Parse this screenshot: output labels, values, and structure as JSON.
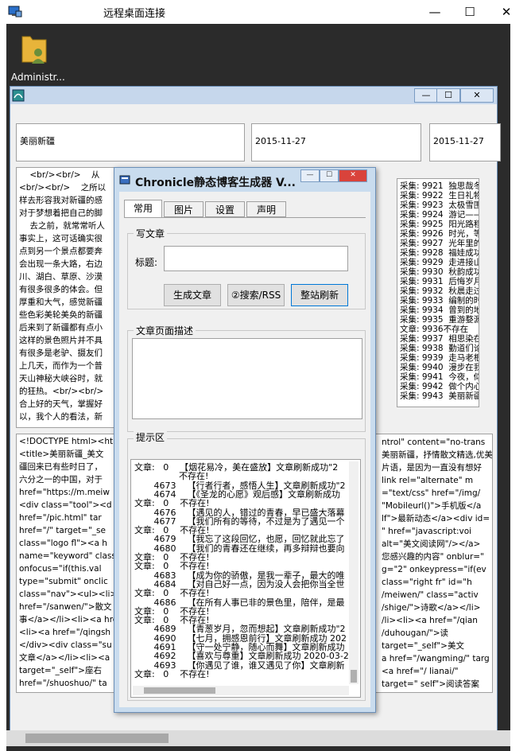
{
  "rdp": {
    "title": "远程桌面连接",
    "min": "—",
    "max": "☐",
    "close": "✕",
    "desktop_icon_label": "Administr..."
  },
  "app": {
    "min": "—",
    "max": "☐",
    "close": "✕",
    "title_field": "美丽新疆",
    "date1": "2015-11-27",
    "date2": "2015-11-27",
    "article_lines": [
      "    <br/><br/>    从",
      "<br/><br/>    之所以",
      "样去形容我对新疆的感",
      "对于梦想着把自己的脚",
      "    去之前，就常常听人",
      "事实上，这可话确实很",
      "点到另一个景点都要奔",
      "会出现一条大路，右边",
      "川、湖白、草原、沙漠",
      "有很多很多的体会。但",
      "厚重和大气，感觉新疆",
      "些色彩美轮美奂的新疆",
      "后来到了新疆都有点小",
      "这样的景色照片并不具",
      "有很多是老驴、摄友们",
      "上几天，而作为一个普",
      "天山神秘大峡谷时，就",
      "的狂热。<br/><br/>",
      "合上好的天气，掌握好",
      "以，我个人的看法，新"
    ],
    "list_lines": [
      "采集: 9921  独思哉冬",
      "采集: 9922  生日礼物",
      "采集: 9923  太极雪围",
      "采集: 9924  游记——",
      "采集: 9925  阳光路程",
      "采集: 9926  时光，等",
      "采集: 9927  光年里的",
      "采集: 9928  福娃成功",
      "采集: 9929  走进接山",
      "采集: 9930  秋韵成功",
      "采集: 9931  后悔岁月",
      "采集: 9932  秋晨走过",
      "采集: 9933  编制的时",
      "采集: 9934  曾到的地",
      "采集: 9935  重游婺源",
      "文章: 9936不存在",
      "采集: 9937  相思染在",
      "采集: 9938  勤道们论",
      "采集: 9939  走马老根",
      "采集: 9940  漫步在我",
      "采集: 9941  今夜，似",
      "采集: 9942  做个内心",
      "采集: 9943  美丽新疆"
    ],
    "html_lines": [
      "<!DOCTYPE html><html",
      "<title>美丽新疆_美文",
      "疆回来已有些时日了，",
      "六分之一的中国，对于",
      "href=\"https://m.meiw",
      "<div class=\"tool\"><d",
      "href=\"/pic.html\" tar",
      "href=\"/\" target=\"_se",
      "class=\"logo fl\"><a h",
      "name=\"keyword\" class",
      "onfocus=\"if(this.val",
      "type=\"submit\" onclic",
      "class=\"nav\"><ul><li>",
      "href=\"/sanwen/\">散文",
      "事</a></li><li><a hre",
      "<li><a href=\"/qingsh",
      "</div><div class=\"su",
      "文章</a></li><li><a",
      "target=\"_self\">座右",
      "href=\"/shuoshuo/\" ta"
    ],
    "html_right_lines": [
      "ntrol\" content=\"no-trans",
      "美丽新疆，抒情散文精选,优美",
      "片语，是因为一直没有想好",
      "link rel=\"alternate\" m",
      "=\"text/css\" href=\"/img/",
      "\"Mobileurl()\">手机版</a",
      "lf\">最新动态</a><div id=",
      "\" href=\"javascript:voi",
      "alt=\"美文阅读网\"/></a>",
      "您感兴趣的内容\" onblur=\"",
      "g=\"2\" onkeypress=\"if(ev",
      "class=\"right fr\" id=\"h",
      "/meiwen/\" class=\"activ",
      "/shige/\">诗歌</a></li>",
      "/li><li><a href=\"/qian",
      "/duhougan/\">读",
      "target=\"_self\">美文",
      "a href=\"/wangming/\" targ",
      "<a href=\"/ lianai/\"",
      "target=\" self\">阅读答案"
    ]
  },
  "dialog": {
    "title": "Chronicle静态博客生成器 V...",
    "min": "—",
    "max": "☐",
    "close": "✕",
    "tabs": [
      "常用",
      "图片",
      "设置",
      "声明"
    ],
    "write_group": "写文章",
    "title_label": "标题:",
    "btn_generate": "生成文章",
    "btn_search": "②搜索/RSS",
    "btn_refresh": "整站刷新",
    "desc_group": "文章页面描述",
    "hint_group": "提示区",
    "log_lines": [
      "文章:   0    【烟花易冷，美在盛放】文章刷新成功\"2",
      "                不存在!",
      "       4673    【行者行者，感悟人生】文章刷新成功\"2",
      "       4674    【《圣龙的心愿》观后感】文章刷新成功",
      "文章:   0    不存在!",
      "       4676    【遇见的人，错过的青春，早已盛大落幕",
      "       4677    【我们所有的等待，不过是为了遇见一个",
      "文章:   0    不存在!",
      "       4679    【我忘了这段回忆，也愿，回忆就此忘了",
      "       4680    【我们的青春还在继续，再多辩辩也要向",
      "文章:   0    不存在!",
      "文章:   0    不存在!",
      "       4683    【成为你的骄傲，是我一辈子，最大的唯",
      "       4684    【对自己好一点，因为没人会把你当全世",
      "文章:   0    不存在!",
      "       4686    【在所有人事已非的景色里，陪伴，是最",
      "文章:   0    不存在!",
      "文章:   0    不存在!",
      "       4689    【青葱岁月，忽而想起】文章刷新成功\"2",
      "       4690    【七月，拥感恩前行】文章刷新成功 202",
      "       4691    【守一处宁静，随心而舞】文章刷新成功",
      "       4692    【喜欢与尊重】文章刷新成功 2020-03-2",
      "       4693    【你遇见了谁，谁又遇见了你】文章刷新",
      "文章:   0    不存在!"
    ]
  }
}
